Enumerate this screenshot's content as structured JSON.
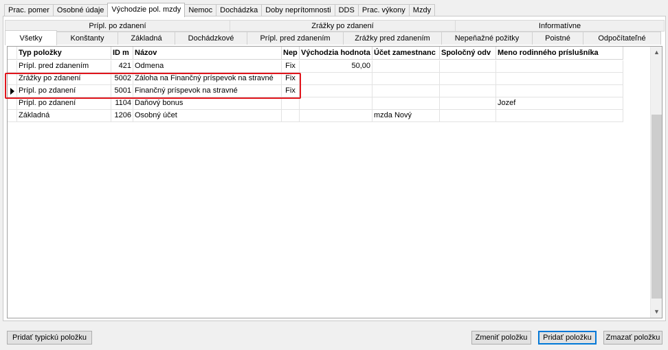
{
  "top_tabs": [
    "Prac. pomer",
    "Osobné údaje",
    "Východzie pol. mzdy",
    "Nemoc",
    "Dochádzka",
    "Doby neprítomnosti",
    "DDS",
    "Prac. výkony",
    "Mzdy"
  ],
  "active_top_tab": "Východzie pol. mzdy",
  "group_headers": [
    "Prípl. po zdanení",
    "Zrážky po zdanení",
    "Informatívne"
  ],
  "sub_tabs": [
    "Všetky",
    "Konštanty",
    "Základná",
    "Dochádzkové",
    "Prípl. pred zdanením",
    "Zrážky pred zdanením",
    "Nepeňažné požitky",
    "Poistné",
    "Odpočítateľné"
  ],
  "active_sub_tab": "Všetky",
  "grid": {
    "columns": [
      "Typ položky",
      "ID m",
      "Názov",
      "Nep",
      "Východzia hodnota",
      "Účet zamestnanc",
      "Spoločný odv",
      "Meno rodinného príslušníka"
    ],
    "rows": [
      [
        "Prípl. pred zdanením",
        "421",
        "Odmena",
        "Fix",
        "50,00",
        "",
        "",
        ""
      ],
      [
        "Zrážky po zdanení",
        "5002",
        "Záloha na Finančný príspevok na stravné",
        "Fix",
        "",
        "",
        "",
        ""
      ],
      [
        "Prípl. po zdanení",
        "5001",
        "Finančný príspevok na stravné",
        "Fix",
        "",
        "",
        "",
        ""
      ],
      [
        "Prípl. po zdanení",
        "1104",
        "Daňový bonus",
        "",
        "",
        "",
        "",
        "Jozef"
      ],
      [
        "Základná",
        "1206",
        "Osobný účet",
        "",
        "",
        "mzda Nový",
        "",
        ""
      ]
    ],
    "current_row": 2
  },
  "buttons": {
    "add_typical": "Pridať typickú položku",
    "change": "Zmeniť položku",
    "add": "Pridať položku",
    "delete": "Zmazať položku"
  },
  "colors": {
    "highlight": "#e0141b",
    "primary_border": "#0078d7"
  }
}
